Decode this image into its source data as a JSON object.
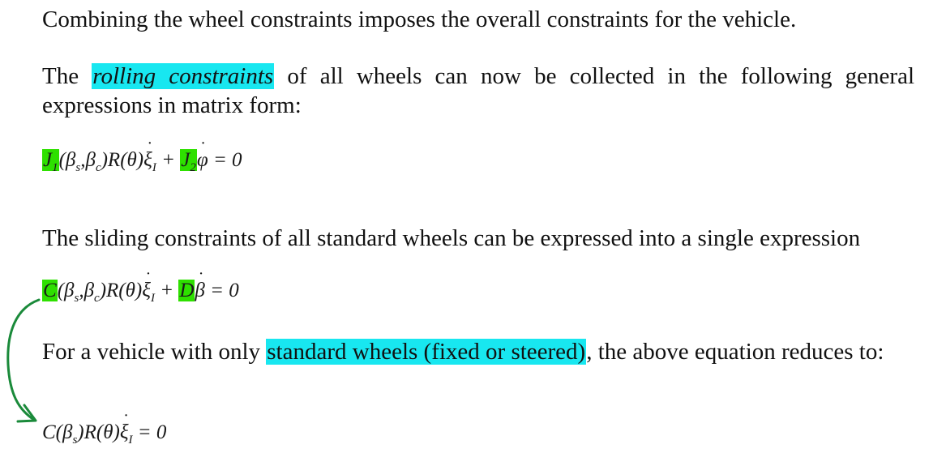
{
  "paragraphs": {
    "p1": "Combining the wheel constraints imposes the overall constraints for the vehicle.",
    "p2_before": "The ",
    "p2_highlight": "rolling constraints",
    "p2_after": " of all wheels can now be collected in the following general expressions in matrix form:",
    "p3": "The sliding constraints of all standard wheels can be expressed into a single expression",
    "p4_before": "For a vehicle with only ",
    "p4_highlight": "standard wheels (fixed or steered)",
    "p4_after": ", the above equation reduces to:"
  },
  "equations": {
    "rolling": {
      "J1": "J",
      "J1_sub": "1",
      "args": "(β",
      "s": "s",
      "comma": ",β",
      "c": "c",
      "rest": ")R(θ)",
      "xi": "ξ",
      "I": "I",
      "plus": " + ",
      "J2": "J",
      "J2_sub": "2",
      "phi": "φ",
      "eq": " = 0"
    },
    "sliding": {
      "C": "C",
      "args": "(β",
      "s": "s",
      "comma": ",β",
      "c": "c",
      "rest": ")R(θ)",
      "xi": "ξ",
      "I": "I",
      "plus": " + ",
      "D": "D",
      "beta": "β",
      "eq": " = 0"
    },
    "reduced": {
      "C": "C(β",
      "s": "s",
      "rest": ")R(θ)",
      "xi": "ξ",
      "I": "I",
      "eq": " = 0"
    }
  },
  "colors": {
    "highlight_cyan": "#18e7f0",
    "highlight_green": "#2ee000",
    "ink_arrow": "#1a8a3a"
  }
}
